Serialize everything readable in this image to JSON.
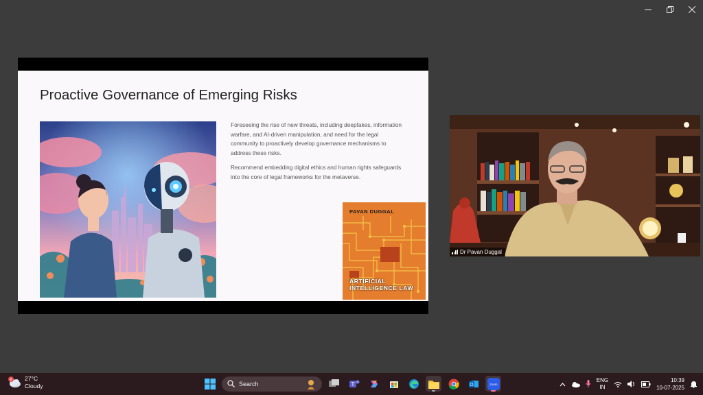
{
  "window": {
    "controls": [
      "minimize",
      "restore",
      "close"
    ]
  },
  "slide": {
    "title": "Proactive Governance of Emerging Risks",
    "bullets": [
      "Foreseeing the rise of new threats, including deepfakes, information warfare, and AI-driven manipulation, and need for the legal community to proactively develop governance mechanisms to address these risks.",
      "Recommend embedding digital ethics and human rights safeguards into the core of legal frameworks for the metaverse."
    ],
    "book": {
      "author": "PAVAN DUGGAL",
      "title_line1": "ARTIFICIAL",
      "title_line2": "INTELLIGENCE LAW"
    }
  },
  "video": {
    "participant_name": "Dr Pavan Duggal"
  },
  "taskbar": {
    "weather": {
      "temp": "27°C",
      "condition": "Cloudy",
      "badge": "6"
    },
    "search_label": "Search",
    "apps": [
      "task-view",
      "teams",
      "copilot",
      "store",
      "edge",
      "file-explorer",
      "chrome",
      "outlook",
      "zoom"
    ],
    "lang_line1": "ENG",
    "lang_line2": "IN",
    "time": "10:39",
    "date": "10-07-2025"
  },
  "colors": {
    "desktop": "#3c3c3c",
    "taskbar": "#2b1a1e",
    "slide_bg": "#fbf8fb",
    "accent": "#e07a2a"
  }
}
